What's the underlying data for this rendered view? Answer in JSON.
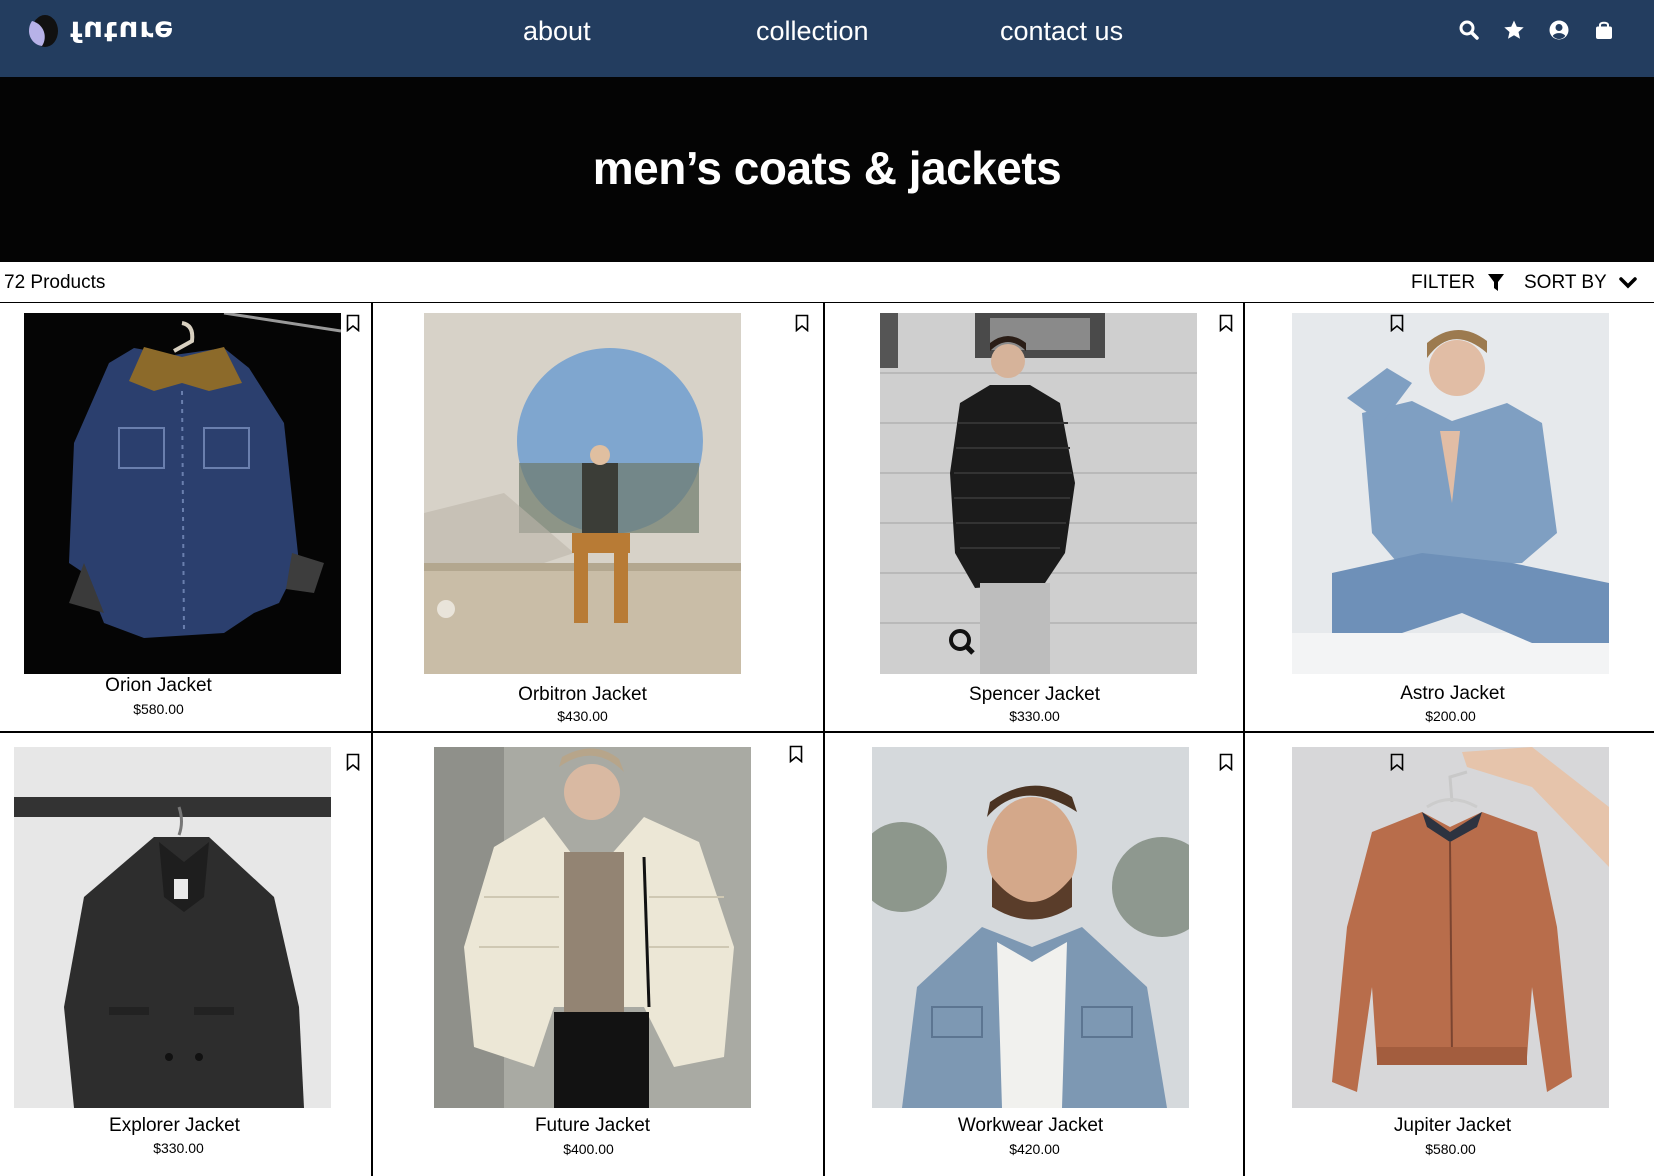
{
  "brand": {
    "logo_text": "future"
  },
  "nav": {
    "links": [
      "about",
      "collection",
      "contact us"
    ],
    "icons": [
      "search-icon",
      "star-icon",
      "user-icon",
      "shopping-bag-icon"
    ]
  },
  "hero": {
    "title": "men’s coats & jackets"
  },
  "toolbar": {
    "count": "72 Products",
    "filter_label": "FILTER",
    "sort_label": "SORT BY"
  },
  "colors": {
    "nav_bg": "#233d5f",
    "hero_bg": "#040404"
  },
  "products": [
    {
      "name": "Orion Jacket",
      "price": "$580.00",
      "image": "dark denim jacket with corduroy collar on hanger"
    },
    {
      "name": "Orbitron Jacket",
      "price": "$430.00",
      "image": "man sitting in front of circular wall opening"
    },
    {
      "name": "Spencer Jacket",
      "price": "$330.00",
      "image": "man in black puffer jacket"
    },
    {
      "name": "Astro Jacket",
      "price": "$200.00",
      "image": "man in denim jumpsuit sitting"
    },
    {
      "name": "Explorer Jacket",
      "price": "$330.00",
      "image": "dark grey wool coat on rail"
    },
    {
      "name": "Future Jacket",
      "price": "$400.00",
      "image": "man in cream puffer jacket"
    },
    {
      "name": "Workwear Jacket",
      "price": "$420.00",
      "image": "bearded man in denim jacket"
    },
    {
      "name": "Jupiter Jacket",
      "price": "$580.00",
      "image": "rust bomber jacket held on hanger"
    }
  ]
}
